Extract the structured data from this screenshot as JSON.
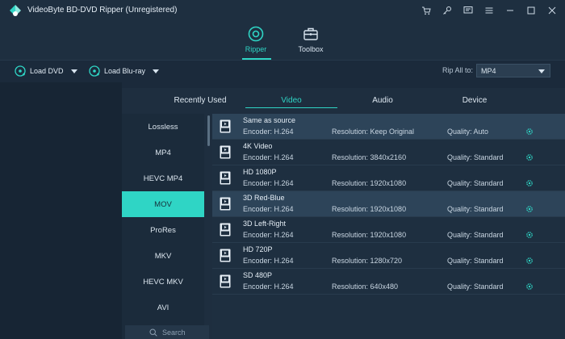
{
  "app": {
    "title": "VideoByte BD-DVD Ripper (Unregistered)"
  },
  "window_icons": [
    "cart-icon",
    "key-icon",
    "feedback-icon",
    "menu-icon",
    "minimize-icon",
    "maximize-icon",
    "close-icon"
  ],
  "nav": {
    "ripper_label": "Ripper",
    "toolbox_label": "Toolbox"
  },
  "toolbar": {
    "load_dvd": "Load DVD",
    "load_bluray": "Load Blu-ray",
    "rip_all_label": "Rip All to:",
    "rip_all_value": "MP4"
  },
  "tabs": {
    "recent": "Recently Used",
    "video": "Video",
    "audio": "Audio",
    "device": "Device"
  },
  "categories": [
    "Lossless",
    "MP4",
    "HEVC MP4",
    "MOV",
    "ProRes",
    "MKV",
    "HEVC MKV",
    "AVI"
  ],
  "active_category": "MOV",
  "search": {
    "placeholder": "Search"
  },
  "formats": [
    {
      "name": "Same as source",
      "encoder": "Encoder: H.264",
      "resolution": "Resolution: Keep Original",
      "quality": "Quality: Auto",
      "badge": ""
    },
    {
      "name": "4K Video",
      "encoder": "Encoder: H.264",
      "resolution": "Resolution: 3840x2160",
      "quality": "Quality: Standard",
      "badge": "4K"
    },
    {
      "name": "HD 1080P",
      "encoder": "Encoder: H.264",
      "resolution": "Resolution: 1920x1080",
      "quality": "Quality: Standard",
      "badge": "1080P"
    },
    {
      "name": "3D Red-Blue",
      "encoder": "Encoder: H.264",
      "resolution": "Resolution: 1920x1080",
      "quality": "Quality: Standard",
      "badge": "3D"
    },
    {
      "name": "3D Left-Right",
      "encoder": "Encoder: H.264",
      "resolution": "Resolution: 1920x1080",
      "quality": "Quality: Standard",
      "badge": "3D"
    },
    {
      "name": "HD 720P",
      "encoder": "Encoder: H.264",
      "resolution": "Resolution: 1280x720",
      "quality": "Quality: Standard",
      "badge": "720P"
    },
    {
      "name": "SD 480P",
      "encoder": "Encoder: H.264",
      "resolution": "Resolution: 640x480",
      "quality": "Quality: Standard",
      "badge": "480P"
    }
  ],
  "colors": {
    "accent": "#2fd5c5",
    "background": "#1b2a3b",
    "panel": "#1e2f40"
  }
}
